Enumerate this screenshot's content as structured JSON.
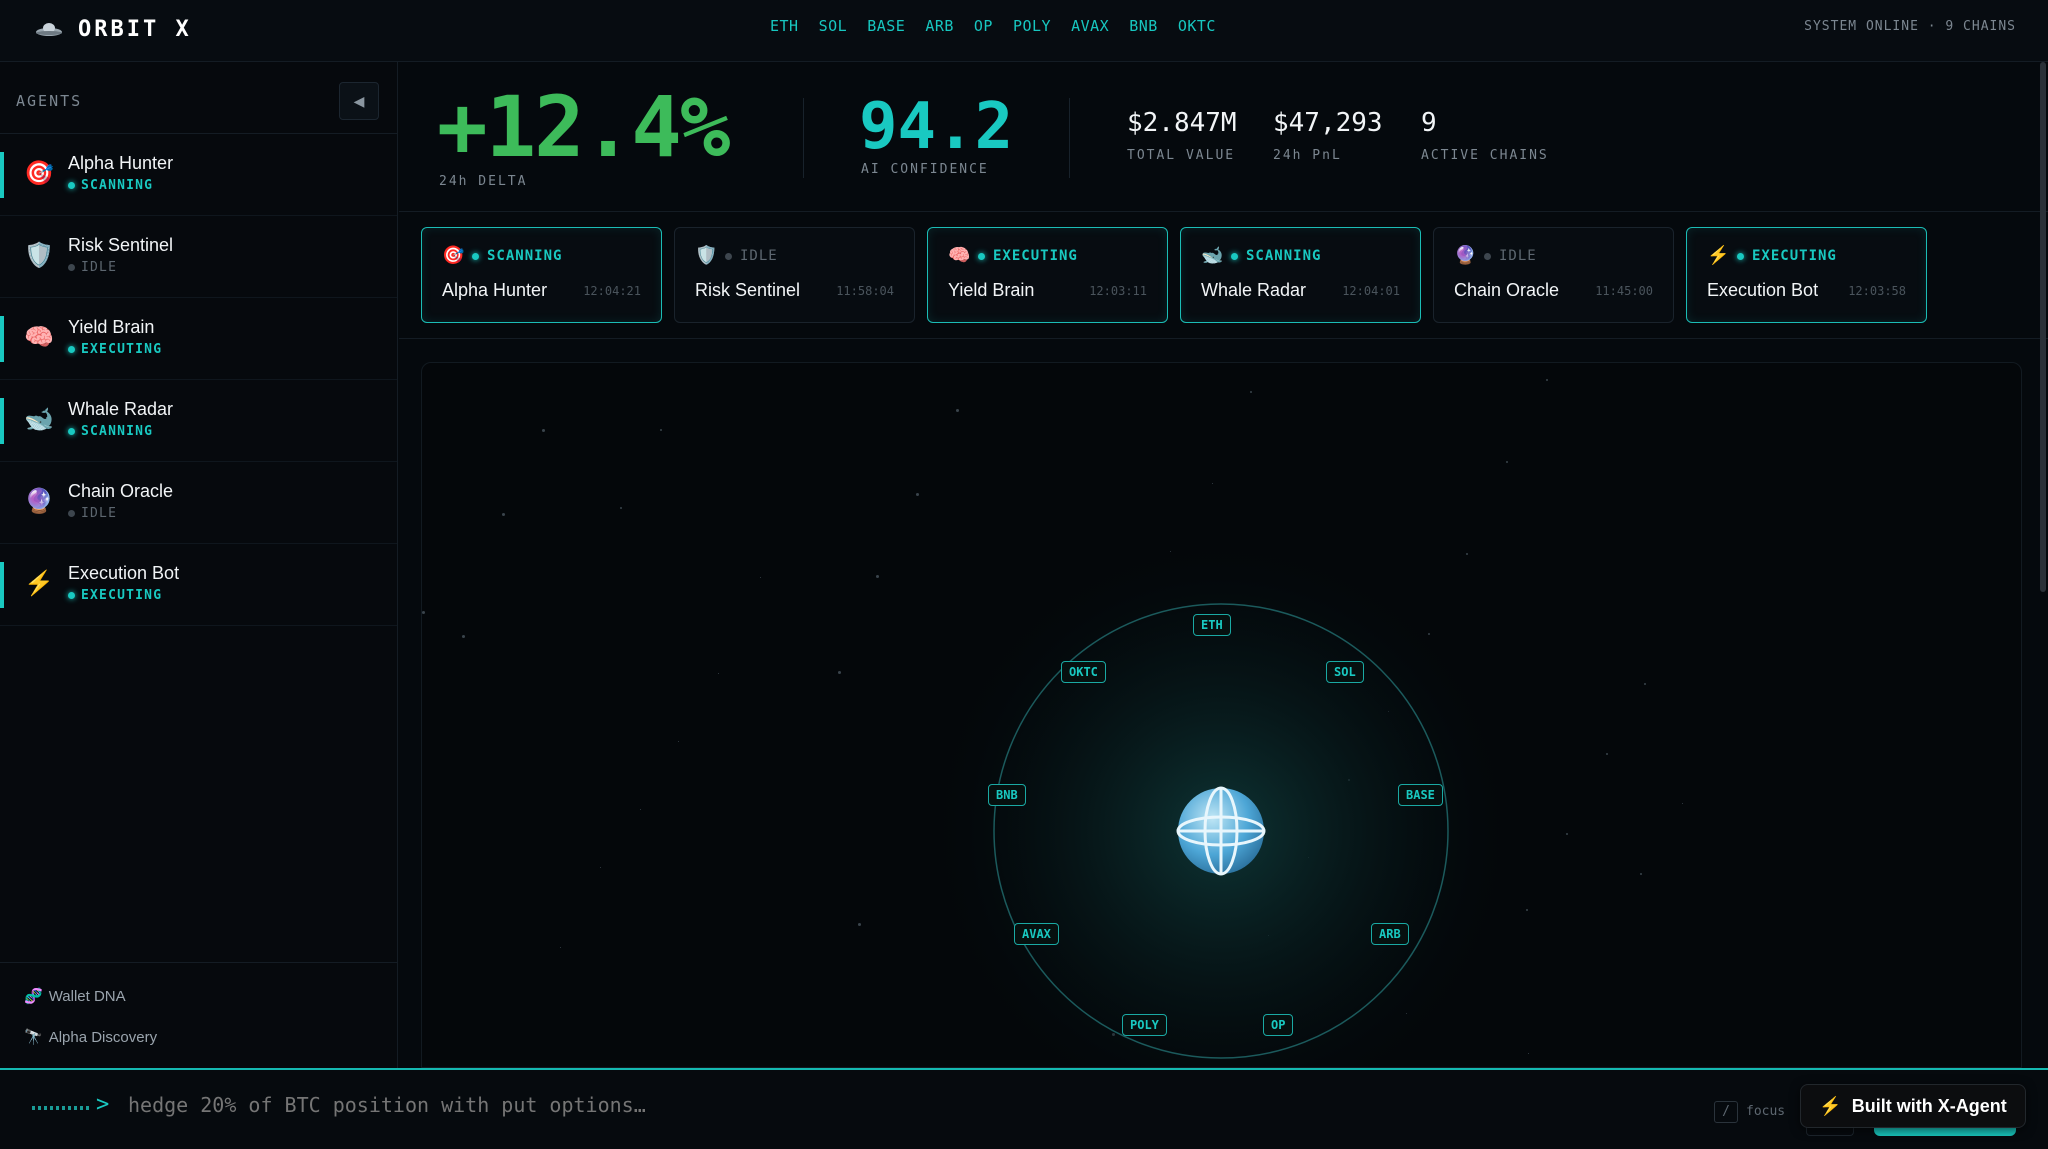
{
  "app": {
    "name": "ORBIT X",
    "logo_icon": "flying-saucer-icon"
  },
  "nav": {
    "chains": [
      "ETH",
      "SOL",
      "BASE",
      "ARB",
      "OP",
      "POLY",
      "AVAX",
      "BNB",
      "OKTC"
    ]
  },
  "system_status": "SYSTEM ONLINE · 9 CHAINS",
  "sidebar": {
    "title": "AGENTS",
    "collapse_icon": "◀",
    "agents": [
      {
        "icon": "🎯",
        "name": "Alpha Hunter",
        "status": "SCANNING",
        "state": "active"
      },
      {
        "icon": "🛡️",
        "name": "Risk Sentinel",
        "status": "IDLE",
        "state": "idle"
      },
      {
        "icon": "🧠",
        "name": "Yield Brain",
        "status": "EXECUTING",
        "state": "active"
      },
      {
        "icon": "🐋",
        "name": "Whale Radar",
        "status": "SCANNING",
        "state": "active"
      },
      {
        "icon": "🔮",
        "name": "Chain Oracle",
        "status": "IDLE",
        "state": "idle"
      },
      {
        "icon": "⚡",
        "name": "Execution Bot",
        "status": "EXECUTING",
        "state": "active"
      }
    ],
    "footer_links": [
      {
        "icon": "🧬",
        "label": "Wallet DNA"
      },
      {
        "icon": "🔭",
        "label": "Alpha Discovery"
      }
    ]
  },
  "stats": {
    "delta": {
      "value": "+12.4%",
      "label": "24h DELTA"
    },
    "confidence": {
      "value": "94.2",
      "label": "AI CONFIDENCE"
    },
    "total_value": {
      "value": "$2.847M",
      "label": "TOTAL VALUE"
    },
    "pnl": {
      "value": "$47,293",
      "label": "24h PnL"
    },
    "active_chains": {
      "value": "9",
      "label": "ACTIVE CHAINS"
    }
  },
  "agent_cards": [
    {
      "icon": "🎯",
      "status": "SCANNING",
      "name": "Alpha Hunter",
      "time": "12:04:21",
      "state": "active"
    },
    {
      "icon": "🛡️",
      "status": "IDLE",
      "name": "Risk Sentinel",
      "time": "11:58:04",
      "state": "idle"
    },
    {
      "icon": "🧠",
      "status": "EXECUTING",
      "name": "Yield Brain",
      "time": "12:03:11",
      "state": "active"
    },
    {
      "icon": "🐋",
      "status": "SCANNING",
      "name": "Whale Radar",
      "time": "12:04:01",
      "state": "active"
    },
    {
      "icon": "🔮",
      "status": "IDLE",
      "name": "Chain Oracle",
      "time": "11:45:00",
      "state": "idle"
    },
    {
      "icon": "⚡",
      "status": "EXECUTING",
      "name": "Execution Bot",
      "time": "12:03:58",
      "state": "active"
    }
  ],
  "orbit": {
    "center_icon": "globe-icon",
    "chain_tags": [
      "ETH",
      "SOL",
      "BASE",
      "ARB",
      "OP",
      "POLY",
      "AVAX",
      "BNB",
      "OKTC"
    ]
  },
  "command": {
    "prompt": ">",
    "value": "hedge 20% of BTC position with put options…",
    "shortcut_key": "/",
    "shortcut_label": "focus"
  },
  "badge": {
    "icon": "⚡",
    "label": "Built with X-Agent"
  },
  "colors": {
    "accent": "#19c9c1",
    "positive": "#3dbb5a",
    "background": "#05090d"
  }
}
